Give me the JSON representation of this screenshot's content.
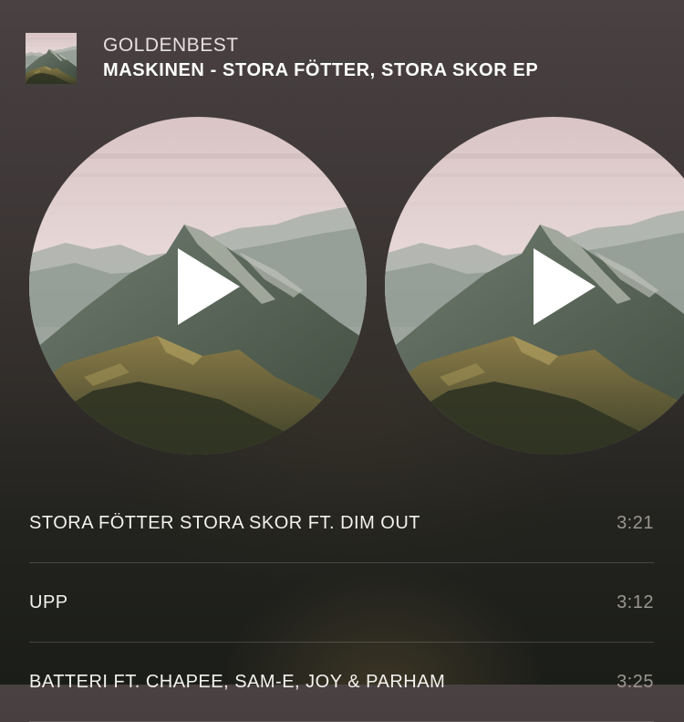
{
  "header": {
    "artist": "GOLDENBEST",
    "album": "MASKINEN - STORA FÖTTER, STORA SKOR EP",
    "cover_icon": "album-cover-mountain"
  },
  "carousel": {
    "items": [
      {
        "icon": "play-icon",
        "art": "mountain-artwork"
      },
      {
        "icon": "play-icon",
        "art": "mountain-artwork"
      }
    ]
  },
  "tracks": [
    {
      "title": "STORA FÖTTER STORA SKOR FT. DIM OUT",
      "duration": "3:21"
    },
    {
      "title": "UPP",
      "duration": "3:12"
    },
    {
      "title": "BATTERI FT. CHAPEE, SAM-E, JOY & PARHAM",
      "duration": "3:25"
    }
  ],
  "colors": {
    "background_top": "#4a4242",
    "background_bottom": "#1b1d19",
    "text_primary": "#ffffff",
    "text_secondary": "#9a9690",
    "divider": "rgba(255,255,255,0.17)"
  }
}
